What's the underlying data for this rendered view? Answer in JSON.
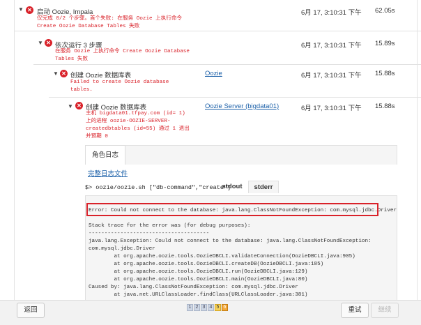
{
  "rows": [
    {
      "title": "启动 Oozie, Impala",
      "error": "仅完成 0/2 个步骤。首个失败: 在服务 Oozie 上执行命令\nCreate Oozie Database Tables 失败",
      "time": "6月 17, 3:10:31 下午",
      "duration": "62.05s"
    },
    {
      "title": "依次运行 3 步骤",
      "error": "在服务 Oozie 上执行命令 Create Oozie Database\nTables 失败",
      "time": "6月 17, 3:10:31 下午",
      "duration": "15.89s"
    },
    {
      "title": "创建 Oozie 数据库表",
      "error": "Failed to create Oozie database\ntables.",
      "context": "Oozie",
      "time": "6月 17, 3:10:31 下午",
      "duration": "15.88s"
    },
    {
      "title": "创建 Oozie 数据库表",
      "error": "主机 bigdata01.tfpay.com (id= 1)\n上的进程 oozie-OOZIE-SERVER-\ncreatedbtables (id=55) 通过 1 退出\n并预期 0",
      "context": "Oozie Server (bigdata01)",
      "time": "6月 17, 3:10:31 下午",
      "duration": "15.88s"
    }
  ],
  "log": {
    "tab_label": "角色日志",
    "full_log_link": "完整日志文件",
    "command": "$> oozie/oozie.sh [\"db-command\",\"create\"]",
    "stdout_tab": "stdout",
    "stderr_tab": "stderr",
    "content": "\nError: Could not connect to the database: java.lang.ClassNotFoundException: com.mysql.jdbc.Driver\n\nStack trace for the error was (for debug purposes):\n--------------------------------------\njava.lang.Exception: Could not connect to the database: java.lang.ClassNotFoundException:\ncom.mysql.jdbc.Driver\n        at org.apache.oozie.tools.OozieDBCLI.validateConnection(OozieDBCLI.java:905)\n        at org.apache.oozie.tools.OozieDBCLI.createDB(OozieDBCLI.java:185)\n        at org.apache.oozie.tools.OozieDBCLI.run(OozieDBCLI.java:129)\n        at org.apache.oozie.tools.OozieDBCLI.main(OozieDBCLI.java:80)\nCaused by: java.lang.ClassNotFoundException: com.mysql.jdbc.Driver\n        at java.net.URLClassLoader.findClass(URLClassLoader.java:381)"
  },
  "footer": {
    "back_label": "返回",
    "retry_label": "重试",
    "continue_label": "继续",
    "pages": [
      "1",
      "2",
      "3",
      "4",
      "5",
      "6"
    ],
    "current_page": "5"
  },
  "colors": {
    "error": "#d9222a",
    "link": "#1a5fa8"
  },
  "icons": {
    "expand": "chevron-down-icon",
    "status": "error-circle-icon"
  }
}
